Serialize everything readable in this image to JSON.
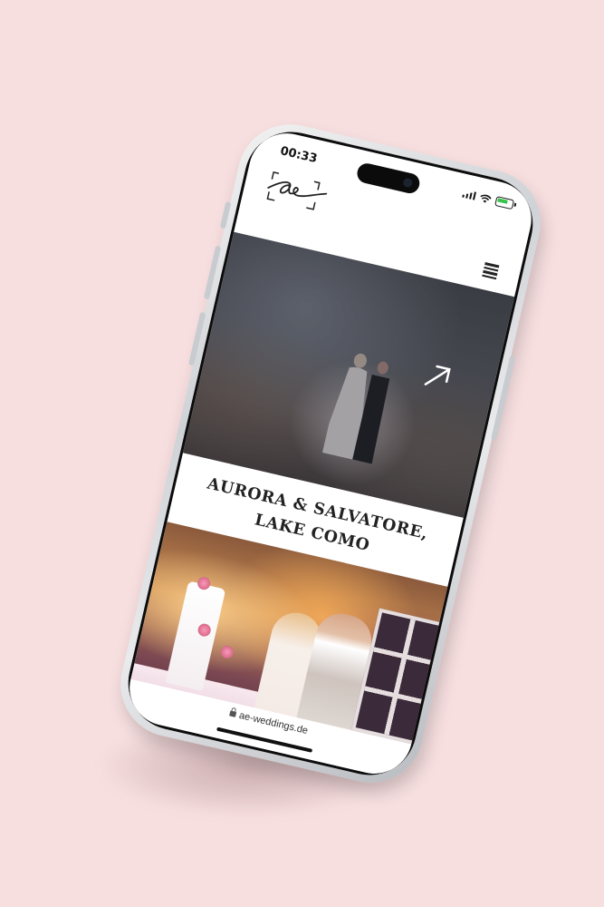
{
  "status_bar": {
    "time": "00:33"
  },
  "site": {
    "logo_text": "ae",
    "menu_icon": "hamburger-menu-icon"
  },
  "featured": {
    "title": "AURORA & SALVATORE, LAKE COMO",
    "link_icon": "arrow-up-right-icon"
  },
  "browser": {
    "url": "ae-weddings.de",
    "lock_icon": "lock-icon"
  },
  "colors": {
    "background": "#f7dfe0",
    "screen": "#ffffff",
    "text": "#222222"
  }
}
